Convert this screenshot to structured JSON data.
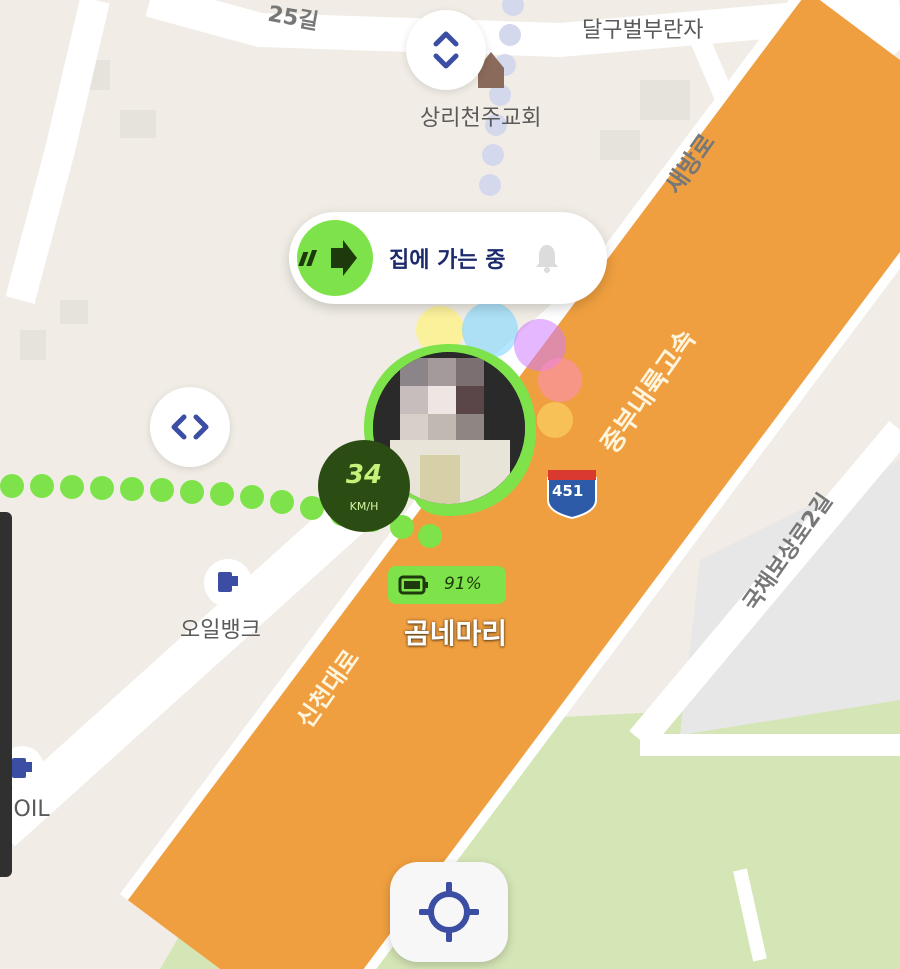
{
  "map": {
    "places": [
      {
        "name": "달구벌부란자"
      },
      {
        "name": "상리천주교회"
      },
      {
        "name": "오일뱅크"
      },
      {
        "name": "-OIL"
      }
    ],
    "roads": {
      "top_road": "25길",
      "saebang_ro": "새방로",
      "highway": "중부내륙고속",
      "sincheon_daero": "신천대로",
      "gukchae_bosang_ro": "국채보상로2길",
      "route_shield": "451"
    },
    "icons": [
      "church-icon",
      "gas-station-icon",
      "route-shield-icon"
    ]
  },
  "status": {
    "text": "집에 가는 중",
    "arrow_icon": "arrow-right-icon",
    "bell_icon": "bell-icon"
  },
  "friend": {
    "name": "곰네마리",
    "speed_value": "34",
    "speed_unit": "KM/H",
    "battery": "91%",
    "battery_level": 0.91
  },
  "controls": {
    "vertical_toggle_icon": "chevron-up-down-icon",
    "horizontal_toggle_icon": "chevron-left-right-icon",
    "locate_icon": "crosshair-icon"
  },
  "colors": {
    "highway": "#ef9f3f",
    "road": "#ffffff",
    "park": "#d7e8b8",
    "accent": "#7ee34a",
    "speed_bg": "#2b4d14",
    "trail": "#7ee34a",
    "trail_blue": "#d4d8ec",
    "icon_blue": "#3b4ea3"
  }
}
